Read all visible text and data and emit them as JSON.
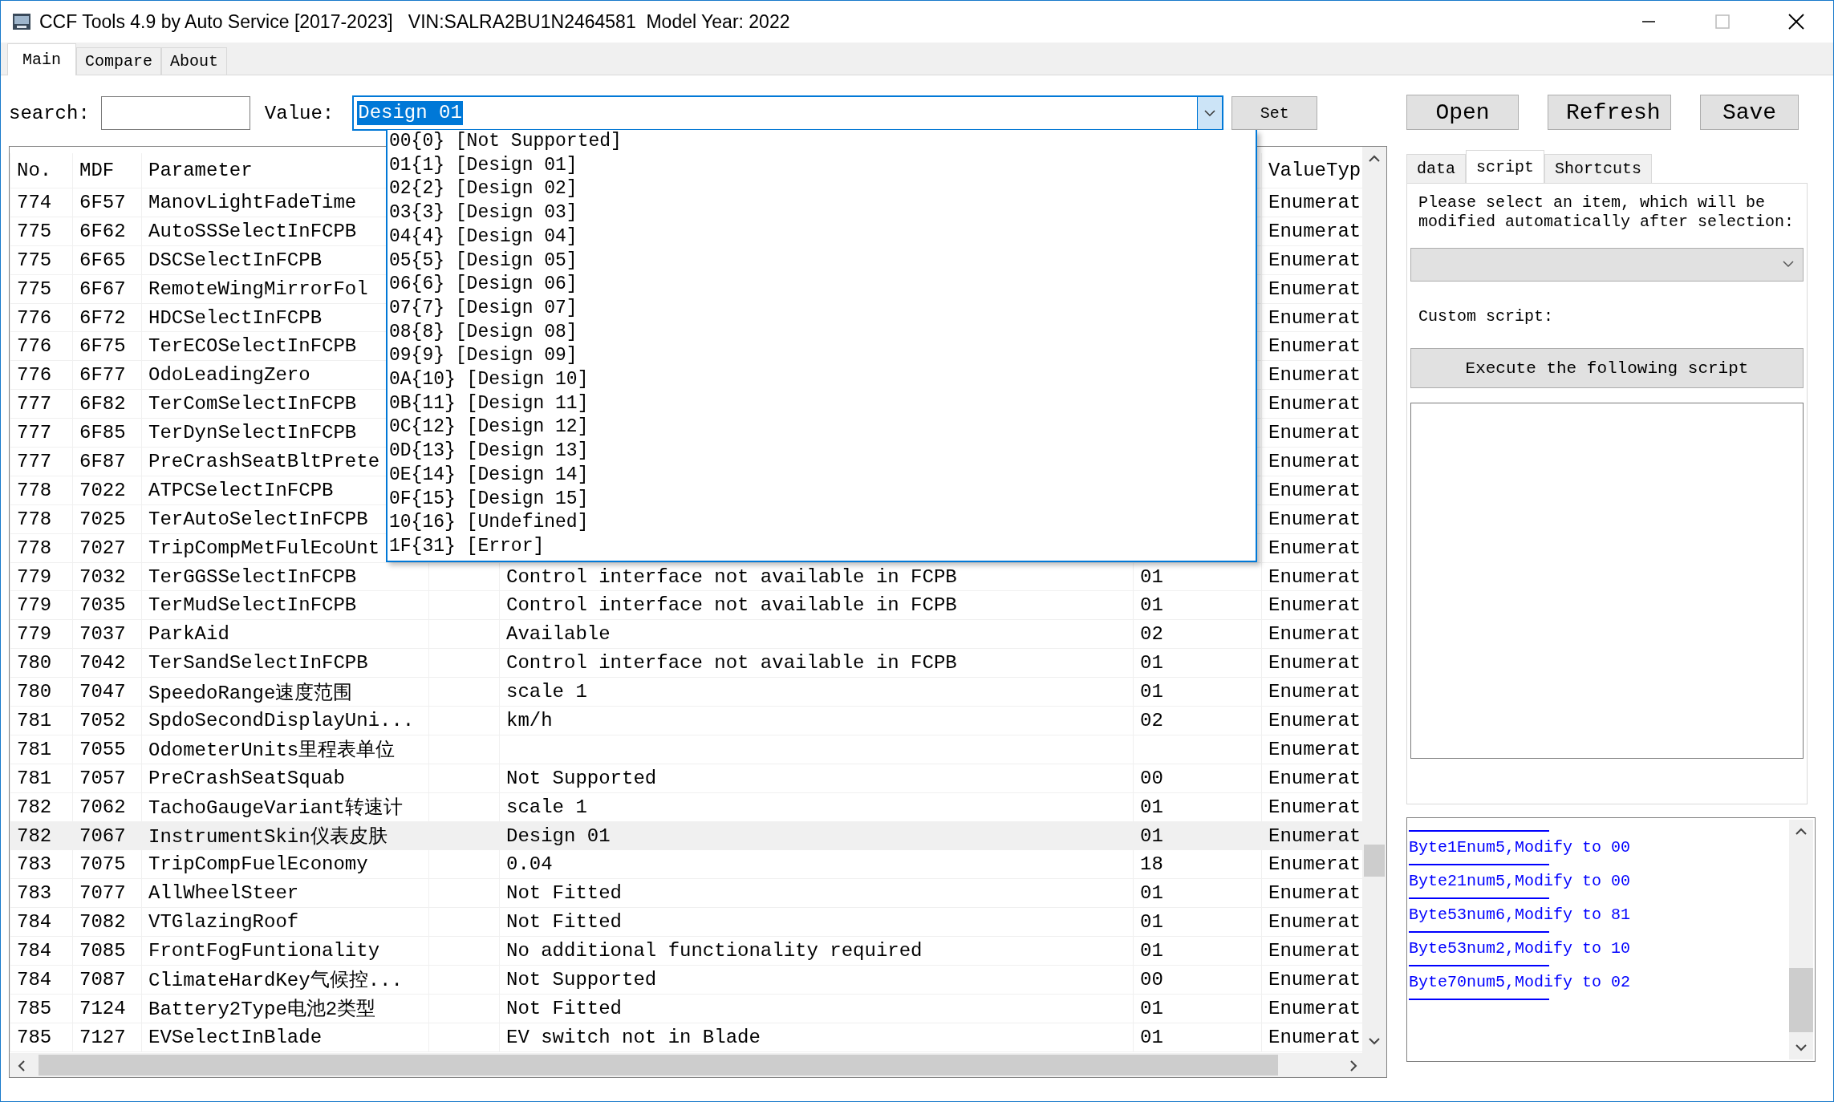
{
  "window": {
    "title": "CCF Tools 4.9 by Auto Service [2017-2023]   VIN:SALRA2BU1N2464581  Model Year: 2022"
  },
  "tabs": [
    {
      "label": "Main",
      "selected": true
    },
    {
      "label": "Compare",
      "selected": false
    },
    {
      "label": "About",
      "selected": false
    }
  ],
  "search": {
    "label": "search:"
  },
  "value_field": {
    "label": "Value:",
    "value": "Design 01",
    "expanded": true,
    "options": [
      "00{0} [Not Supported]",
      "01{1} [Design 01]",
      "02{2} [Design 02]",
      "03{3} [Design 03]",
      "04{4} [Design 04]",
      "05{5} [Design 05]",
      "06{6} [Design 06]",
      "07{7} [Design 07]",
      "08{8} [Design 08]",
      "09{9} [Design 09]",
      "0A{10} [Design 10]",
      "0B{11} [Design 11]",
      "0C{12} [Design 12]",
      "0D{13} [Design 13]",
      "0E{14} [Design 14]",
      "0F{15} [Design 15]",
      "10{16} [Undefined]",
      "1F{31} [Error]"
    ]
  },
  "set_button": "Set",
  "file_buttons": [
    "Open",
    "Refresh",
    "Save"
  ],
  "table": {
    "columns": [
      "No.",
      "MDF",
      "Parameter",
      "ValueTyp"
    ],
    "rows": [
      {
        "no": "774",
        "mdf": "6F57",
        "parameter": "ManovLightFadeTime",
        "type": "Enumerat",
        "selected": false
      },
      {
        "no": "775",
        "mdf": "6F62",
        "parameter": "AutoSSSelectInFCPB",
        "type": "Enumerat",
        "selected": false
      },
      {
        "no": "775",
        "mdf": "6F65",
        "parameter": "DSCSelectInFCPB",
        "type": "Enumerat",
        "selected": false
      },
      {
        "no": "775",
        "mdf": "6F67",
        "parameter": "RemoteWingMirrorFol",
        "type": "Enumerat",
        "selected": false
      },
      {
        "no": "776",
        "mdf": "6F72",
        "parameter": "HDCSelectInFCPB",
        "type": "Enumerat",
        "selected": false
      },
      {
        "no": "776",
        "mdf": "6F75",
        "parameter": "TerECOSelectInFCPB",
        "type": "Enumerat",
        "selected": false
      },
      {
        "no": "776",
        "mdf": "6F77",
        "parameter": "OdoLeadingZero",
        "type": "Enumerat",
        "selected": false
      },
      {
        "no": "777",
        "mdf": "6F82",
        "parameter": "TerComSelectInFCPB",
        "type": "Enumerat",
        "selected": false
      },
      {
        "no": "777",
        "mdf": "6F85",
        "parameter": "TerDynSelectInFCPB",
        "type": "Enumerat",
        "selected": false
      },
      {
        "no": "777",
        "mdf": "6F87",
        "parameter": "PreCrashSeatBltPrete",
        "type": "Enumerat",
        "selected": false
      },
      {
        "no": "778",
        "mdf": "7022",
        "parameter": "ATPCSelectInFCPB",
        "type": "Enumerat",
        "selected": false
      },
      {
        "no": "778",
        "mdf": "7025",
        "parameter": "TerAutoSelectInFCPB",
        "type": "Enumerat",
        "selected": false
      },
      {
        "no": "778",
        "mdf": "7027",
        "parameter": "TripCompMetFulEcoUnt",
        "type": "Enumerat",
        "selected": false
      },
      {
        "no": "779",
        "mdf": "7032",
        "parameter": "TerGGSSelectInFCPB",
        "value": "Control interface not available in FCPB",
        "raw": "01",
        "type": "Enumerat",
        "selected": false
      },
      {
        "no": "779",
        "mdf": "7035",
        "parameter": "TerMudSelectInFCPB",
        "value": "Control interface not available in FCPB",
        "raw": "01",
        "type": "Enumerat",
        "selected": false
      },
      {
        "no": "779",
        "mdf": "7037",
        "parameter": "ParkAid",
        "value": "Available",
        "raw": "02",
        "type": "Enumerat",
        "selected": false
      },
      {
        "no": "780",
        "mdf": "7042",
        "parameter": "TerSandSelectInFCPB",
        "value": "Control interface not available in FCPB",
        "raw": "01",
        "type": "Enumerat",
        "selected": false
      },
      {
        "no": "780",
        "mdf": "7047",
        "parameter": "SpeedoRange速度范围",
        "value": "scale 1",
        "raw": "01",
        "type": "Enumerat",
        "selected": false
      },
      {
        "no": "781",
        "mdf": "7052",
        "parameter": "SpdoSecondDisplayUni...",
        "value": "km/h",
        "raw": "02",
        "type": "Enumerat",
        "selected": false
      },
      {
        "no": "781",
        "mdf": "7055",
        "parameter": "OdometerUnits里程表单位",
        "type": "Enumerat",
        "selected": false
      },
      {
        "no": "781",
        "mdf": "7057",
        "parameter": "PreCrashSeatSquab",
        "value": "Not Supported",
        "raw": "00",
        "type": "Enumerat",
        "selected": false
      },
      {
        "no": "782",
        "mdf": "7062",
        "parameter": "TachoGaugeVariant转速计",
        "value": "scale 1",
        "raw": "01",
        "type": "Enumerat",
        "selected": false
      },
      {
        "no": "782",
        "mdf": "7067",
        "parameter": "InstrumentSkin仪表皮肤",
        "value": "Design 01",
        "raw": "01",
        "type": "Enumerat",
        "selected": true
      },
      {
        "no": "783",
        "mdf": "7075",
        "parameter": "TripCompFuelEconomy",
        "value": "0.04",
        "raw": "18",
        "type": "Enumerat",
        "selected": false
      },
      {
        "no": "783",
        "mdf": "7077",
        "parameter": "AllWheelSteer",
        "value": "Not Fitted",
        "raw": "01",
        "type": "Enumerat",
        "selected": false
      },
      {
        "no": "784",
        "mdf": "7082",
        "parameter": "VTGlazingRoof",
        "value": "Not Fitted",
        "raw": "01",
        "type": "Enumerat",
        "selected": false
      },
      {
        "no": "784",
        "mdf": "7085",
        "parameter": "FrontFogFuntionality",
        "value": "No additional functionality required",
        "raw": "01",
        "type": "Enumerat",
        "selected": false
      },
      {
        "no": "784",
        "mdf": "7087",
        "parameter": "ClimateHardKey气候控...",
        "value": "Not Supported",
        "raw": "00",
        "type": "Enumerat",
        "selected": false
      },
      {
        "no": "785",
        "mdf": "7124",
        "parameter": "Battery2Type电池2类型",
        "value": "Not Fitted",
        "raw": "01",
        "type": "Enumerat",
        "selected": false
      },
      {
        "no": "785",
        "mdf": "7127",
        "parameter": "EVSelectInBlade",
        "value": "EV switch not in Blade",
        "raw": "01",
        "type": "Enumerat",
        "selected": false
      }
    ]
  },
  "side_tabs": [
    {
      "label": "data",
      "selected": false
    },
    {
      "label": "script",
      "selected": true
    },
    {
      "label": "Shortcuts",
      "selected": false
    }
  ],
  "script_panel": {
    "hint": "Please select an item, which will be modified automatically after selection:",
    "custom_label": "Custom script:",
    "execute_button": "Execute the following script"
  },
  "log": [
    "Byte1Enum5,Modify to 00",
    "Byte21num5,Modify to 00",
    "Byte53num6,Modify to 81",
    "Byte53num2,Modify to 10",
    "Byte70num5,Modify to 02"
  ]
}
